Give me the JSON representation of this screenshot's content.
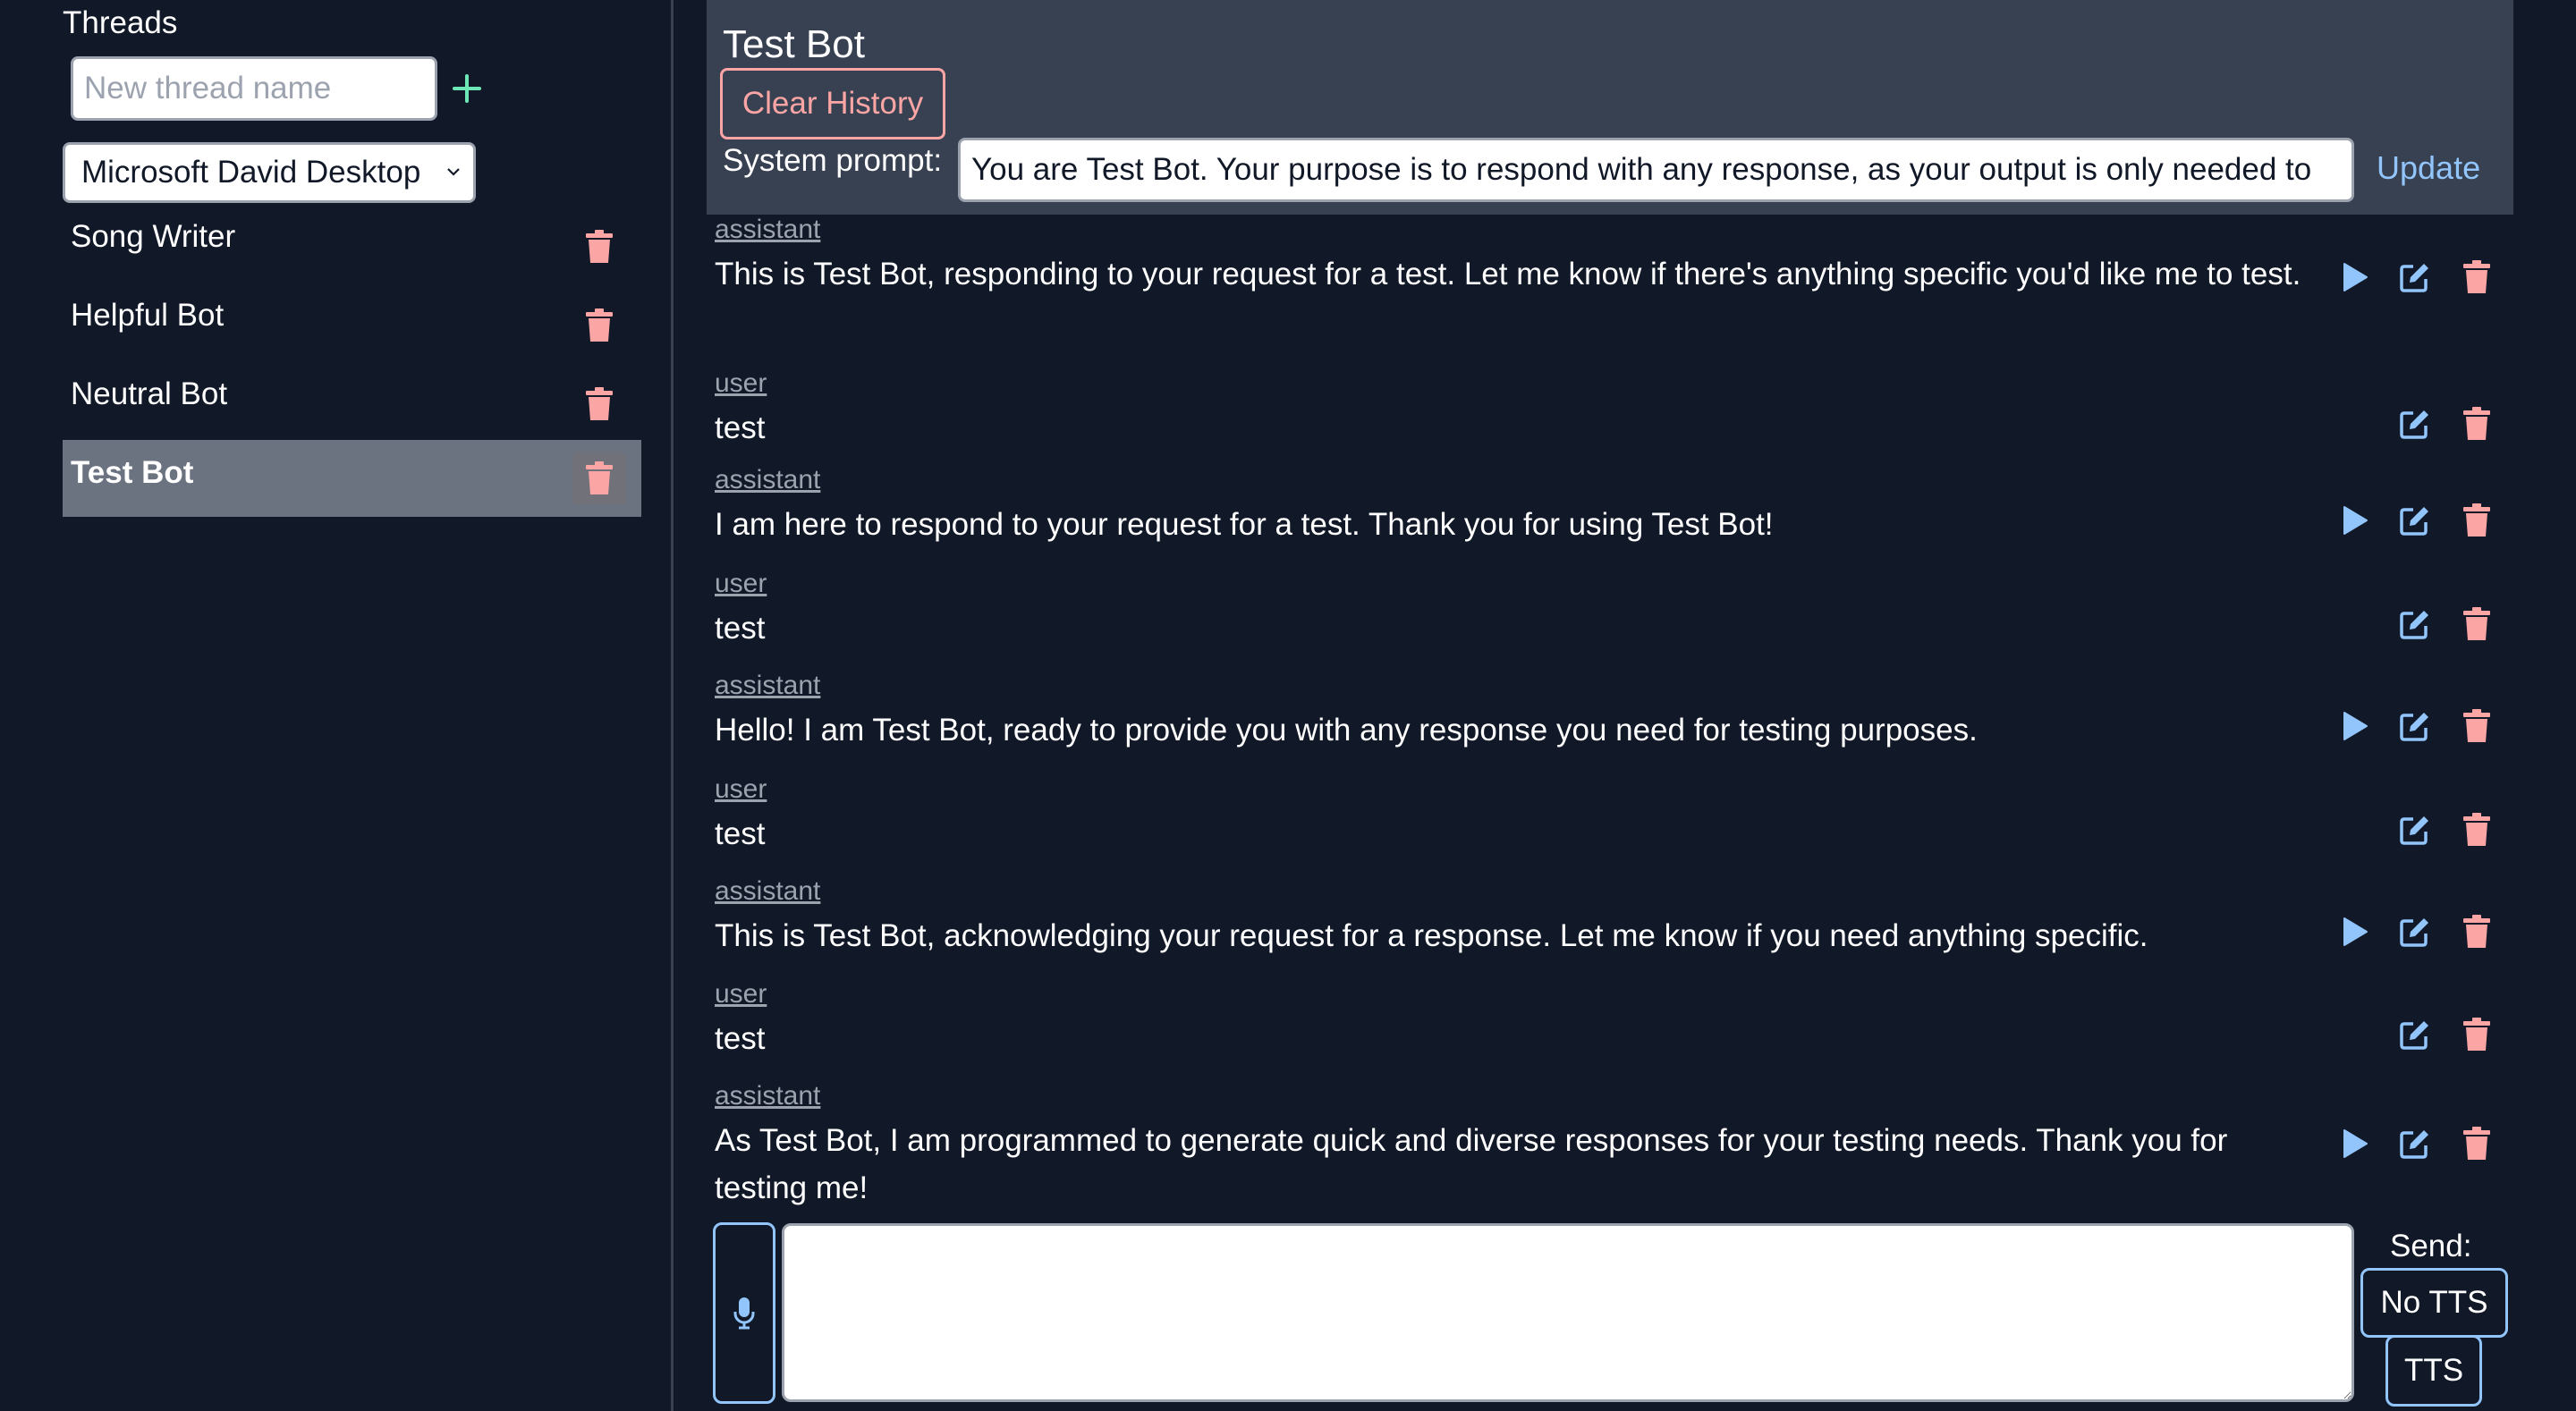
{
  "sidebar": {
    "title": "Threads",
    "new_thread_placeholder": "New thread name",
    "voice_selected": "Microsoft David Desktop",
    "threads": [
      {
        "name": "Song Writer"
      },
      {
        "name": "Helpful Bot"
      },
      {
        "name": "Neutral Bot"
      },
      {
        "name": "Test Bot",
        "active": true
      }
    ]
  },
  "header": {
    "title": "Test Bot",
    "clear_label": "Clear History",
    "system_prompt_label": "System prompt:",
    "system_prompt_value": "You are Test Bot. Your purpose is to respond with any response, as your output is only needed to",
    "update_label": "Update"
  },
  "messages": [
    {
      "role": "assistant",
      "text": "This is Test Bot, responding to your request for a test. Let me know if there's anything specific you'd like me to test."
    },
    {
      "role": "user",
      "text": "test"
    },
    {
      "role": "assistant",
      "text": "I am here to respond to your request for a test. Thank you for using Test Bot!"
    },
    {
      "role": "user",
      "text": "test"
    },
    {
      "role": "assistant",
      "text": "Hello! I am Test Bot, ready to provide you with any response you need for testing purposes."
    },
    {
      "role": "user",
      "text": "test"
    },
    {
      "role": "assistant",
      "text": "This is Test Bot, acknowledging your request for a response. Let me know if you need anything specific."
    },
    {
      "role": "user",
      "text": "test"
    },
    {
      "role": "assistant",
      "text": "As Test Bot, I am programmed to generate quick and diverse responses for your testing needs. Thank you for testing me!"
    }
  ],
  "composer": {
    "value": "",
    "send_label": "Send:",
    "no_tts_label": "No TTS",
    "tts_label": "TTS"
  },
  "colors": {
    "background": "#111827",
    "header_bg": "#374151",
    "active_thread_bg": "#6b7280",
    "delete_icon": "#fca5a5",
    "accent_blue": "#93c5fd",
    "add_green": "#6ee7b7"
  },
  "icons": {
    "add": "plus-icon",
    "delete": "trash-icon",
    "play": "play-icon",
    "edit": "edit-icon",
    "mic": "microphone-icon",
    "dropdown": "chevron-down-icon"
  }
}
